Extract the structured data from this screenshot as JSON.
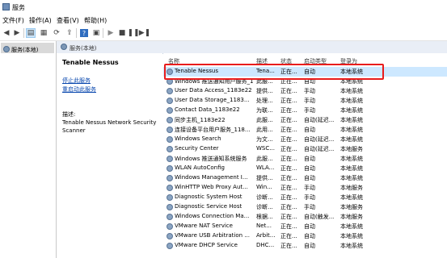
{
  "window": {
    "title": "服务"
  },
  "menu": [
    {
      "label": "文件(F)"
    },
    {
      "label": "操作(A)"
    },
    {
      "label": "查看(V)"
    },
    {
      "label": "帮助(H)"
    }
  ],
  "toolbar": {
    "icons": [
      "back-icon",
      "forward-icon",
      "console-tree-icon",
      "properties-icon",
      "refresh-icon",
      "export-icon",
      "help-icon",
      "console-icon",
      "start-icon",
      "stop-icon",
      "pause-icon",
      "restart-icon"
    ]
  },
  "tree": {
    "root_label": "服务(本地)"
  },
  "header": {
    "label": "服务(本地)"
  },
  "extended": {
    "service_name": "Tenable Nessus",
    "stop_link": "停止此服务",
    "restart_link": "重启动此服务",
    "desc_label": "描述:",
    "description": "Tenable Nessus Network Security Scanner"
  },
  "columns": {
    "name": "名称",
    "desc": "描述",
    "status": "状态",
    "startup": "启动类型",
    "logon": "登录为"
  },
  "services": [
    {
      "name": "Tenable Nessus",
      "desc": "Tena...",
      "status": "正在...",
      "startup": "自动",
      "logon": "本地系统"
    },
    {
      "name": "Windows 推送通知用户服务_1...",
      "desc": "此服...",
      "status": "正在...",
      "startup": "自动",
      "logon": "本地系统"
    },
    {
      "name": "User Data Access_1183e22",
      "desc": "提供...",
      "status": "正在...",
      "startup": "手动",
      "logon": "本地系统"
    },
    {
      "name": "User Data Storage_1183...",
      "desc": "处理...",
      "status": "正在...",
      "startup": "手动",
      "logon": "本地系统"
    },
    {
      "name": "Contact Data_1183e22",
      "desc": "为联...",
      "status": "正在...",
      "startup": "手动",
      "logon": "本地系统"
    },
    {
      "name": "同步主机_1183e22",
      "desc": "此服...",
      "status": "正在...",
      "startup": "自动(延迟...",
      "logon": "本地系统"
    },
    {
      "name": "连接设备平台用户服务_118...",
      "desc": "此用...",
      "status": "正在...",
      "startup": "自动",
      "logon": "本地系统"
    },
    {
      "name": "Windows Search",
      "desc": "为文...",
      "status": "正在...",
      "startup": "自动(延迟...",
      "logon": "本地系统"
    },
    {
      "name": "Security Center",
      "desc": "WSC...",
      "status": "正在...",
      "startup": "自动(延迟...",
      "logon": "本地服务"
    },
    {
      "name": "Windows 推送通知系统服务",
      "desc": "此服...",
      "status": "正在...",
      "startup": "自动",
      "logon": "本地系统"
    },
    {
      "name": "WLAN AutoConfig",
      "desc": "WLA...",
      "status": "正在...",
      "startup": "自动",
      "logon": "本地系统"
    },
    {
      "name": "Windows Management I...",
      "desc": "提供...",
      "status": "正在...",
      "startup": "自动",
      "logon": "本地系统"
    },
    {
      "name": "WinHTTP Web Proxy Aut...",
      "desc": "Win...",
      "status": "正在...",
      "startup": "手动",
      "logon": "本地服务"
    },
    {
      "name": "Diagnostic System Host",
      "desc": "诊断...",
      "status": "正在...",
      "startup": "手动",
      "logon": "本地系统"
    },
    {
      "name": "Diagnostic Service Host",
      "desc": "诊断...",
      "status": "正在...",
      "startup": "手动",
      "logon": "本地服务"
    },
    {
      "name": "Windows Connection Ma...",
      "desc": "根据...",
      "status": "正在...",
      "startup": "自动(触发...",
      "logon": "本地服务"
    },
    {
      "name": "VMware NAT Service",
      "desc": "Net...",
      "status": "正在...",
      "startup": "自动",
      "logon": "本地系统"
    },
    {
      "name": "VMware USB Arbitration ...",
      "desc": "Arbit...",
      "status": "正在...",
      "startup": "自动",
      "logon": "本地系统"
    },
    {
      "name": "VMware DHCP Service",
      "desc": "DHC...",
      "status": "正在...",
      "startup": "自动",
      "logon": "本地系统"
    }
  ]
}
